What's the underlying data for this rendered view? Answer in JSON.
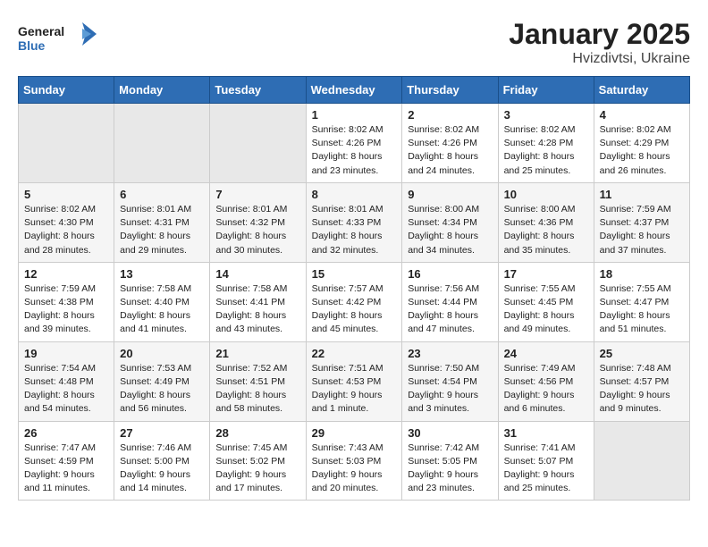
{
  "header": {
    "logo_line1": "General",
    "logo_line2": "Blue",
    "month": "January 2025",
    "location": "Hvizdivtsi, Ukraine"
  },
  "weekdays": [
    "Sunday",
    "Monday",
    "Tuesday",
    "Wednesday",
    "Thursday",
    "Friday",
    "Saturday"
  ],
  "weeks": [
    [
      {
        "day": "",
        "sunrise": "",
        "sunset": "",
        "daylight": ""
      },
      {
        "day": "",
        "sunrise": "",
        "sunset": "",
        "daylight": ""
      },
      {
        "day": "",
        "sunrise": "",
        "sunset": "",
        "daylight": ""
      },
      {
        "day": "1",
        "sunrise": "Sunrise: 8:02 AM",
        "sunset": "Sunset: 4:26 PM",
        "daylight": "Daylight: 8 hours and 23 minutes."
      },
      {
        "day": "2",
        "sunrise": "Sunrise: 8:02 AM",
        "sunset": "Sunset: 4:26 PM",
        "daylight": "Daylight: 8 hours and 24 minutes."
      },
      {
        "day": "3",
        "sunrise": "Sunrise: 8:02 AM",
        "sunset": "Sunset: 4:28 PM",
        "daylight": "Daylight: 8 hours and 25 minutes."
      },
      {
        "day": "4",
        "sunrise": "Sunrise: 8:02 AM",
        "sunset": "Sunset: 4:29 PM",
        "daylight": "Daylight: 8 hours and 26 minutes."
      }
    ],
    [
      {
        "day": "5",
        "sunrise": "Sunrise: 8:02 AM",
        "sunset": "Sunset: 4:30 PM",
        "daylight": "Daylight: 8 hours and 28 minutes."
      },
      {
        "day": "6",
        "sunrise": "Sunrise: 8:01 AM",
        "sunset": "Sunset: 4:31 PM",
        "daylight": "Daylight: 8 hours and 29 minutes."
      },
      {
        "day": "7",
        "sunrise": "Sunrise: 8:01 AM",
        "sunset": "Sunset: 4:32 PM",
        "daylight": "Daylight: 8 hours and 30 minutes."
      },
      {
        "day": "8",
        "sunrise": "Sunrise: 8:01 AM",
        "sunset": "Sunset: 4:33 PM",
        "daylight": "Daylight: 8 hours and 32 minutes."
      },
      {
        "day": "9",
        "sunrise": "Sunrise: 8:00 AM",
        "sunset": "Sunset: 4:34 PM",
        "daylight": "Daylight: 8 hours and 34 minutes."
      },
      {
        "day": "10",
        "sunrise": "Sunrise: 8:00 AM",
        "sunset": "Sunset: 4:36 PM",
        "daylight": "Daylight: 8 hours and 35 minutes."
      },
      {
        "day": "11",
        "sunrise": "Sunrise: 7:59 AM",
        "sunset": "Sunset: 4:37 PM",
        "daylight": "Daylight: 8 hours and 37 minutes."
      }
    ],
    [
      {
        "day": "12",
        "sunrise": "Sunrise: 7:59 AM",
        "sunset": "Sunset: 4:38 PM",
        "daylight": "Daylight: 8 hours and 39 minutes."
      },
      {
        "day": "13",
        "sunrise": "Sunrise: 7:58 AM",
        "sunset": "Sunset: 4:40 PM",
        "daylight": "Daylight: 8 hours and 41 minutes."
      },
      {
        "day": "14",
        "sunrise": "Sunrise: 7:58 AM",
        "sunset": "Sunset: 4:41 PM",
        "daylight": "Daylight: 8 hours and 43 minutes."
      },
      {
        "day": "15",
        "sunrise": "Sunrise: 7:57 AM",
        "sunset": "Sunset: 4:42 PM",
        "daylight": "Daylight: 8 hours and 45 minutes."
      },
      {
        "day": "16",
        "sunrise": "Sunrise: 7:56 AM",
        "sunset": "Sunset: 4:44 PM",
        "daylight": "Daylight: 8 hours and 47 minutes."
      },
      {
        "day": "17",
        "sunrise": "Sunrise: 7:55 AM",
        "sunset": "Sunset: 4:45 PM",
        "daylight": "Daylight: 8 hours and 49 minutes."
      },
      {
        "day": "18",
        "sunrise": "Sunrise: 7:55 AM",
        "sunset": "Sunset: 4:47 PM",
        "daylight": "Daylight: 8 hours and 51 minutes."
      }
    ],
    [
      {
        "day": "19",
        "sunrise": "Sunrise: 7:54 AM",
        "sunset": "Sunset: 4:48 PM",
        "daylight": "Daylight: 8 hours and 54 minutes."
      },
      {
        "day": "20",
        "sunrise": "Sunrise: 7:53 AM",
        "sunset": "Sunset: 4:49 PM",
        "daylight": "Daylight: 8 hours and 56 minutes."
      },
      {
        "day": "21",
        "sunrise": "Sunrise: 7:52 AM",
        "sunset": "Sunset: 4:51 PM",
        "daylight": "Daylight: 8 hours and 58 minutes."
      },
      {
        "day": "22",
        "sunrise": "Sunrise: 7:51 AM",
        "sunset": "Sunset: 4:53 PM",
        "daylight": "Daylight: 9 hours and 1 minute."
      },
      {
        "day": "23",
        "sunrise": "Sunrise: 7:50 AM",
        "sunset": "Sunset: 4:54 PM",
        "daylight": "Daylight: 9 hours and 3 minutes."
      },
      {
        "day": "24",
        "sunrise": "Sunrise: 7:49 AM",
        "sunset": "Sunset: 4:56 PM",
        "daylight": "Daylight: 9 hours and 6 minutes."
      },
      {
        "day": "25",
        "sunrise": "Sunrise: 7:48 AM",
        "sunset": "Sunset: 4:57 PM",
        "daylight": "Daylight: 9 hours and 9 minutes."
      }
    ],
    [
      {
        "day": "26",
        "sunrise": "Sunrise: 7:47 AM",
        "sunset": "Sunset: 4:59 PM",
        "daylight": "Daylight: 9 hours and 11 minutes."
      },
      {
        "day": "27",
        "sunrise": "Sunrise: 7:46 AM",
        "sunset": "Sunset: 5:00 PM",
        "daylight": "Daylight: 9 hours and 14 minutes."
      },
      {
        "day": "28",
        "sunrise": "Sunrise: 7:45 AM",
        "sunset": "Sunset: 5:02 PM",
        "daylight": "Daylight: 9 hours and 17 minutes."
      },
      {
        "day": "29",
        "sunrise": "Sunrise: 7:43 AM",
        "sunset": "Sunset: 5:03 PM",
        "daylight": "Daylight: 9 hours and 20 minutes."
      },
      {
        "day": "30",
        "sunrise": "Sunrise: 7:42 AM",
        "sunset": "Sunset: 5:05 PM",
        "daylight": "Daylight: 9 hours and 23 minutes."
      },
      {
        "day": "31",
        "sunrise": "Sunrise: 7:41 AM",
        "sunset": "Sunset: 5:07 PM",
        "daylight": "Daylight: 9 hours and 25 minutes."
      },
      {
        "day": "",
        "sunrise": "",
        "sunset": "",
        "daylight": ""
      }
    ]
  ]
}
